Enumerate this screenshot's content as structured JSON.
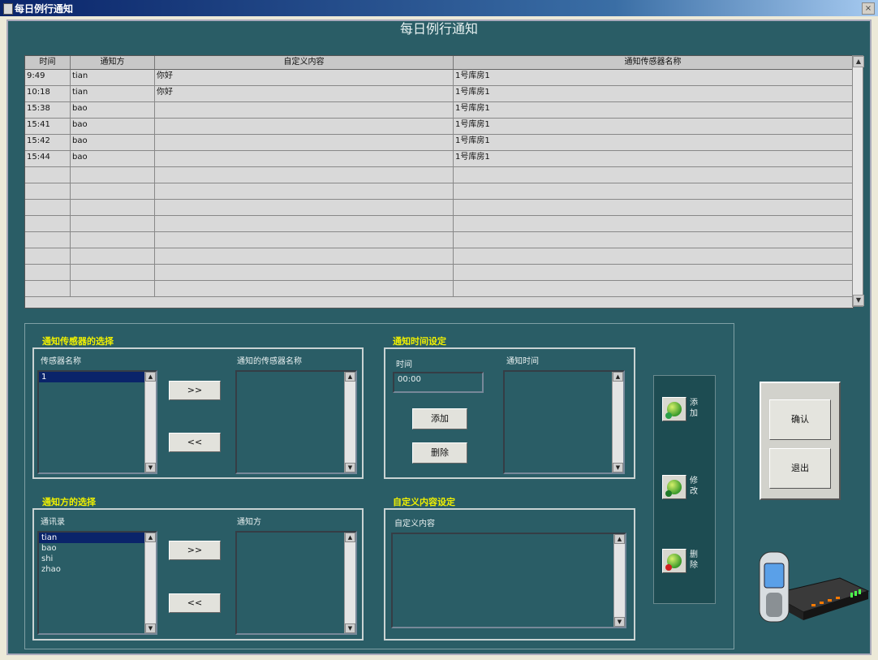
{
  "window": {
    "title": "每日例行通知",
    "close_glyph": "×"
  },
  "main": {
    "title": "每日例行通知"
  },
  "grid": {
    "headers": [
      "时间",
      "通知方",
      "自定义内容",
      "通知传感器名称"
    ],
    "rows": [
      [
        "9:49",
        "tian",
        "你好",
        "1号库房1"
      ],
      [
        "10:18",
        "tian",
        "你好",
        "1号库房1"
      ],
      [
        "15:38",
        "bao",
        "",
        "1号库房1"
      ],
      [
        "15:41",
        "bao",
        "",
        "1号库房1"
      ],
      [
        "15:42",
        "bao",
        "",
        "1号库房1"
      ],
      [
        "15:44",
        "bao",
        "",
        "1号库房1"
      ]
    ]
  },
  "sensor_select": {
    "title": "通知传感器的选择",
    "left_label": "传感器名称",
    "right_label": "通知的传感器名称",
    "items": [
      "1"
    ],
    "add_label": ">>",
    "remove_label": "<<"
  },
  "time_setting": {
    "title": "通知时间设定",
    "time_label": "时间",
    "time_value": "00:00",
    "notify_time_label": "通知时间",
    "add_label": "添加",
    "delete_label": "删除"
  },
  "party_select": {
    "title": "通知方的选择",
    "left_label": "通讯录",
    "right_label": "通知方",
    "items": [
      "tian",
      "bao",
      "shi",
      "zhao"
    ],
    "add_label": ">>",
    "remove_label": "<<"
  },
  "content_setting": {
    "title": "自定义内容设定",
    "label": "自定义内容"
  },
  "actions": {
    "add_chars": [
      "添",
      "加"
    ],
    "modify_chars": [
      "修",
      "改"
    ],
    "delete_chars": [
      "删",
      "除"
    ]
  },
  "dialog_buttons": {
    "confirm": "确认",
    "exit": "退出"
  },
  "scroll": {
    "up": "▲",
    "down": "▼"
  },
  "colors": {
    "panel": "#2a5d66",
    "title_yellow": "#f0f000",
    "selection": "#0a246a"
  }
}
